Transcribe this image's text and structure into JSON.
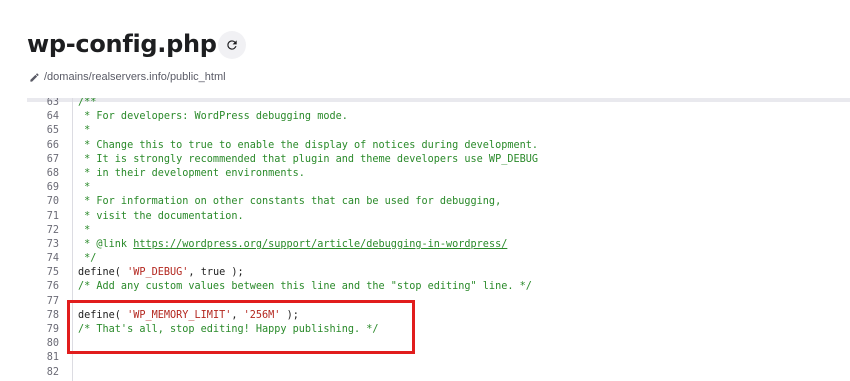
{
  "header": {
    "title": "wp-config.php",
    "path": "/domains/realservers.info/public_html"
  },
  "editor": {
    "lines": [
      {
        "num": "63",
        "parts": [
          {
            "t": "/**",
            "c": "cm"
          }
        ]
      },
      {
        "num": "64",
        "parts": [
          {
            "t": " * For developers: WordPress debugging mode.",
            "c": "cm"
          }
        ]
      },
      {
        "num": "65",
        "parts": [
          {
            "t": " *",
            "c": "cm"
          }
        ]
      },
      {
        "num": "66",
        "parts": [
          {
            "t": " * Change this to true to enable the display of notices during development.",
            "c": "cm"
          }
        ]
      },
      {
        "num": "67",
        "parts": [
          {
            "t": " * It is strongly recommended that plugin and theme developers use WP_DEBUG",
            "c": "cm"
          }
        ]
      },
      {
        "num": "68",
        "parts": [
          {
            "t": " * in their development environments.",
            "c": "cm"
          }
        ]
      },
      {
        "num": "69",
        "parts": [
          {
            "t": " *",
            "c": "cm"
          }
        ]
      },
      {
        "num": "70",
        "parts": [
          {
            "t": " * For information on other constants that can be used for debugging,",
            "c": "cm"
          }
        ]
      },
      {
        "num": "71",
        "parts": [
          {
            "t": " * visit the documentation.",
            "c": "cm"
          }
        ]
      },
      {
        "num": "72",
        "parts": [
          {
            "t": " *",
            "c": "cm"
          }
        ]
      },
      {
        "num": "73",
        "parts": [
          {
            "t": " * @link ",
            "c": "cm"
          },
          {
            "t": "https://wordpress.org/support/article/debugging-in-wordpress/",
            "c": "link"
          }
        ]
      },
      {
        "num": "74",
        "parts": [
          {
            "t": " */",
            "c": "cm"
          }
        ]
      },
      {
        "num": "75",
        "parts": [
          {
            "t": "define( ",
            "c": "kw"
          },
          {
            "t": "'WP_DEBUG'",
            "c": "str"
          },
          {
            "t": ", true );",
            "c": "kw"
          }
        ]
      },
      {
        "num": "76",
        "parts": [
          {
            "t": "/* Add any custom values between this line and the \"stop editing\" line. */",
            "c": "cm"
          }
        ]
      },
      {
        "num": "77",
        "parts": []
      },
      {
        "num": "78",
        "parts": [
          {
            "t": "define( ",
            "c": "kw"
          },
          {
            "t": "'WP_MEMORY_LIMIT'",
            "c": "str"
          },
          {
            "t": ", ",
            "c": "kw"
          },
          {
            "t": "'256M'",
            "c": "str"
          },
          {
            "t": " );",
            "c": "kw"
          }
        ]
      },
      {
        "num": "79",
        "parts": [
          {
            "t": "/* That's all, stop editing! Happy publishing. */",
            "c": "cm"
          }
        ]
      },
      {
        "num": "80",
        "parts": []
      },
      {
        "num": "81",
        "parts": []
      },
      {
        "num": "82",
        "parts": []
      }
    ]
  },
  "icons": {
    "refresh": "refresh-icon",
    "edit": "pencil-icon"
  },
  "colors": {
    "comment": "#2a8a2a",
    "string": "#b3261e",
    "highlight": "#e11d1d"
  }
}
